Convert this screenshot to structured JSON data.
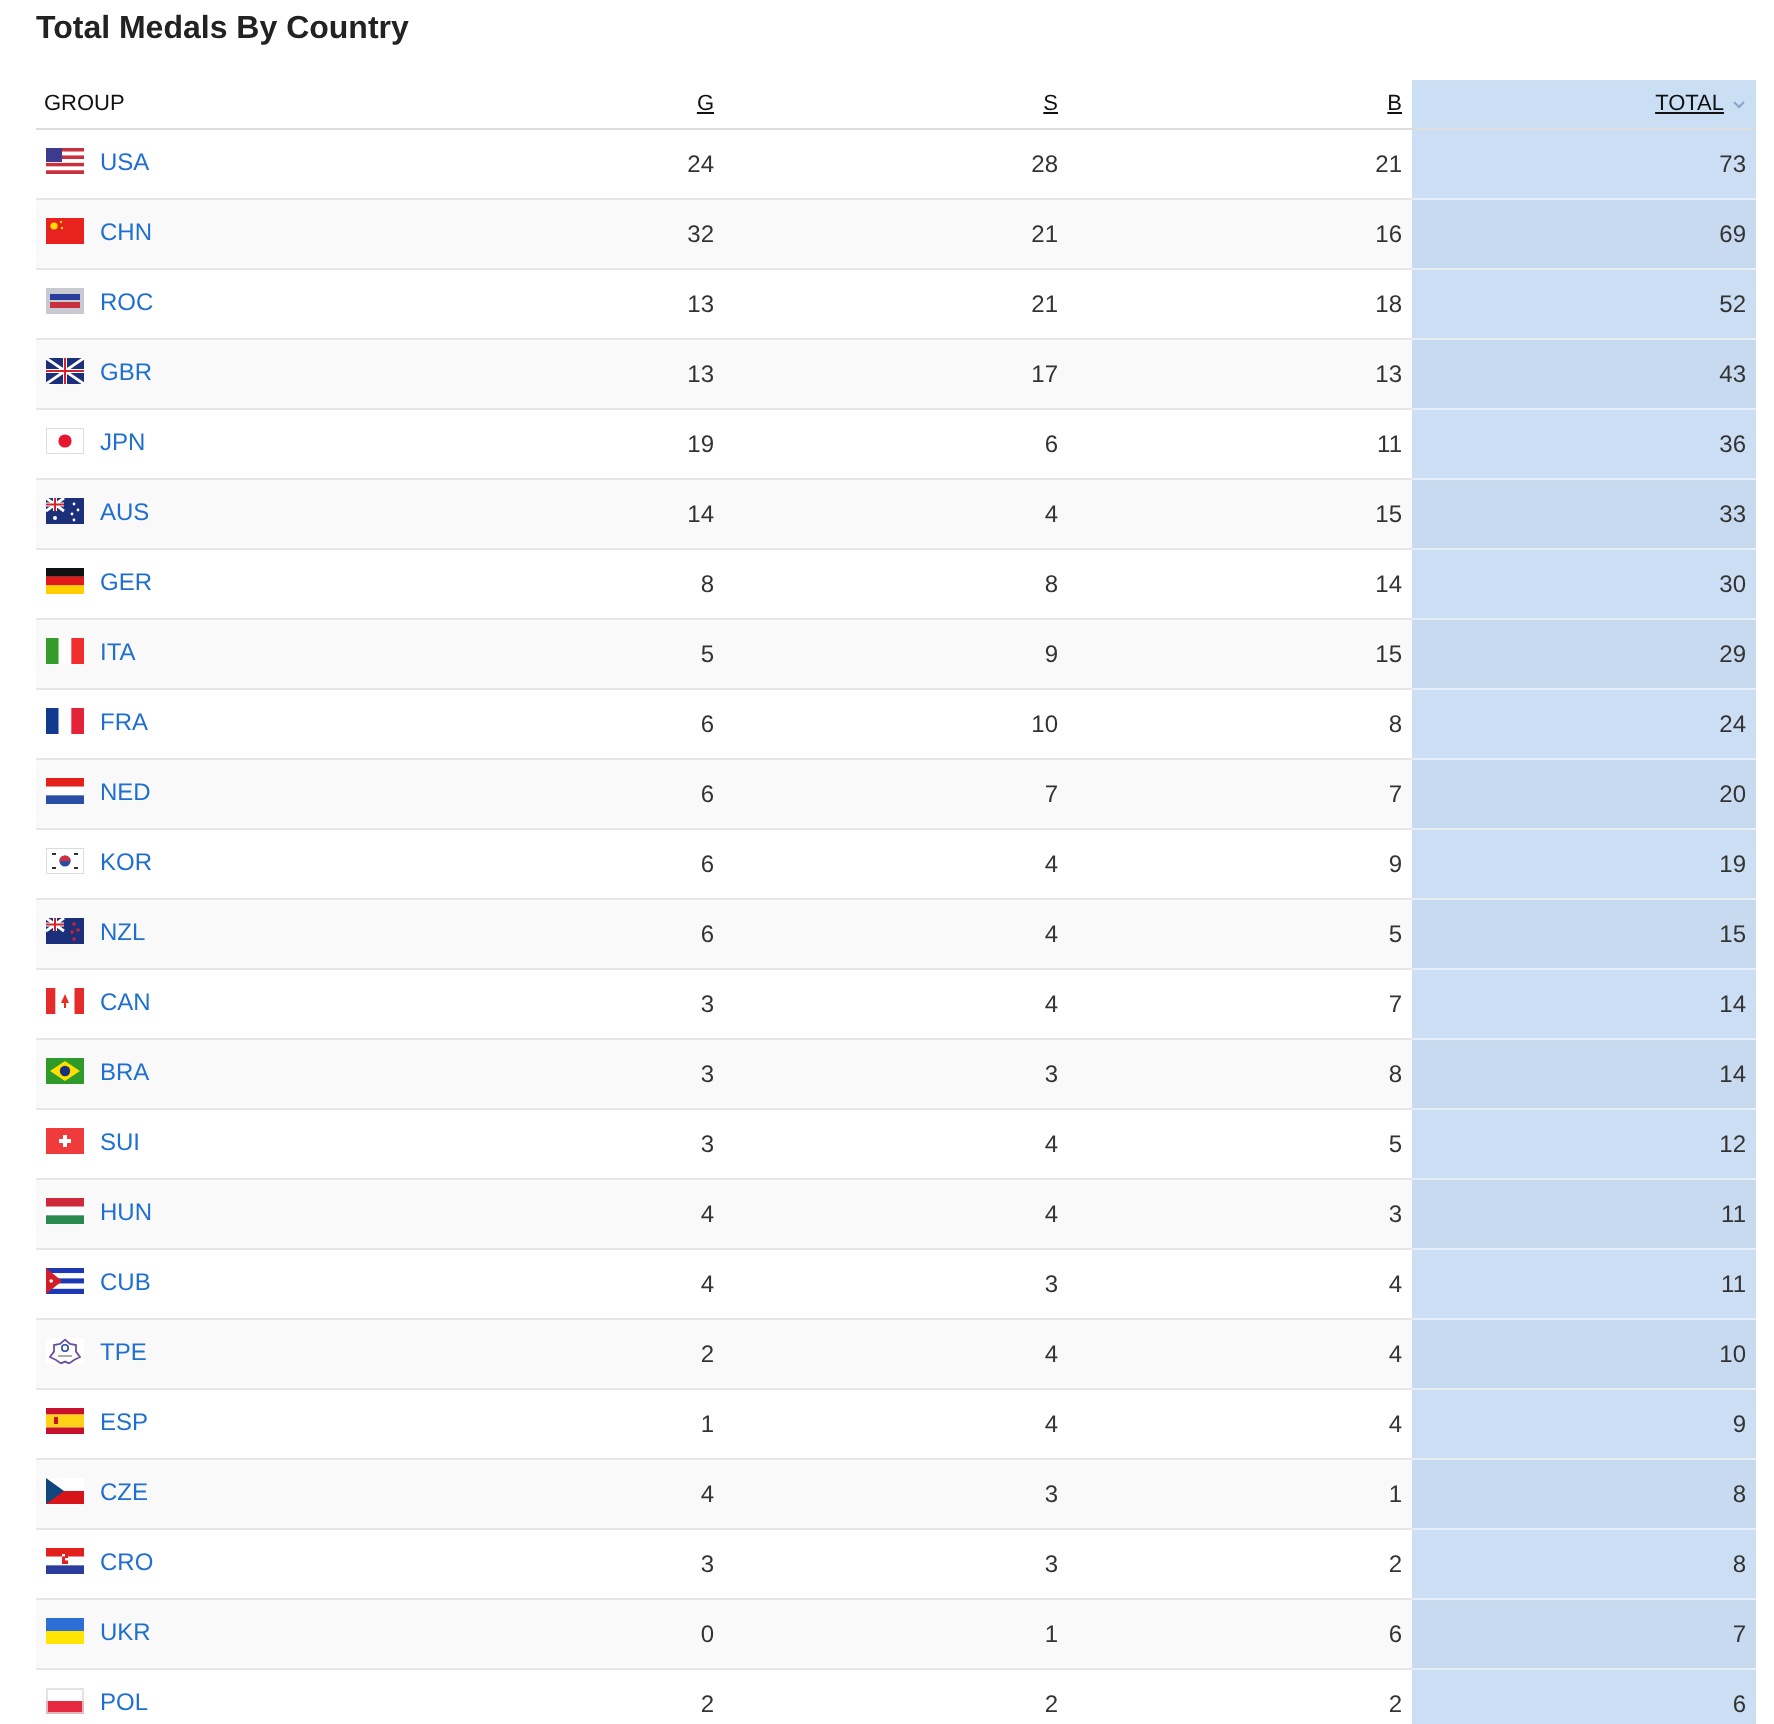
{
  "title": "Total Medals By Country",
  "table": {
    "columns": [
      {
        "label": "GROUP",
        "sortable": false,
        "sorted": false
      },
      {
        "label": "G",
        "sortable": true,
        "sorted": false
      },
      {
        "label": "S",
        "sortable": true,
        "sorted": false
      },
      {
        "label": "B",
        "sortable": true,
        "sorted": false
      },
      {
        "label": "TOTAL",
        "sortable": true,
        "sorted": true
      }
    ],
    "rows": [
      {
        "group": "USA",
        "values": [
          "24",
          "28",
          "21",
          "73"
        ]
      },
      {
        "group": "CHN",
        "values": [
          "32",
          "21",
          "16",
          "69"
        ]
      },
      {
        "group": "ROC",
        "values": [
          "13",
          "21",
          "18",
          "52"
        ]
      },
      {
        "group": "GBR",
        "values": [
          "13",
          "17",
          "13",
          "43"
        ]
      },
      {
        "group": "JPN",
        "values": [
          "19",
          "6",
          "11",
          "36"
        ]
      },
      {
        "group": "AUS",
        "values": [
          "14",
          "4",
          "15",
          "33"
        ]
      },
      {
        "group": "GER",
        "values": [
          "8",
          "8",
          "14",
          "30"
        ]
      },
      {
        "group": "ITA",
        "values": [
          "5",
          "9",
          "15",
          "29"
        ]
      },
      {
        "group": "FRA",
        "values": [
          "6",
          "10",
          "8",
          "24"
        ]
      },
      {
        "group": "NED",
        "values": [
          "6",
          "7",
          "7",
          "20"
        ]
      },
      {
        "group": "KOR",
        "values": [
          "6",
          "4",
          "9",
          "19"
        ]
      },
      {
        "group": "NZL",
        "values": [
          "6",
          "4",
          "5",
          "15"
        ]
      },
      {
        "group": "CAN",
        "values": [
          "3",
          "4",
          "7",
          "14"
        ]
      },
      {
        "group": "BRA",
        "values": [
          "3",
          "3",
          "8",
          "14"
        ]
      },
      {
        "group": "SUI",
        "values": [
          "3",
          "4",
          "5",
          "12"
        ]
      },
      {
        "group": "HUN",
        "values": [
          "4",
          "4",
          "3",
          "11"
        ]
      },
      {
        "group": "CUB",
        "values": [
          "4",
          "3",
          "4",
          "11"
        ]
      },
      {
        "group": "TPE",
        "values": [
          "2",
          "4",
          "4",
          "10"
        ]
      },
      {
        "group": "ESP",
        "values": [
          "1",
          "4",
          "4",
          "9"
        ]
      },
      {
        "group": "CZE",
        "values": [
          "4",
          "3",
          "1",
          "8"
        ]
      },
      {
        "group": "CRO",
        "values": [
          "3",
          "3",
          "2",
          "8"
        ]
      },
      {
        "group": "UKR",
        "values": [
          "0",
          "1",
          "6",
          "7"
        ]
      },
      {
        "group": "POL",
        "values": [
          "2",
          "2",
          "2",
          "6"
        ]
      }
    ]
  }
}
